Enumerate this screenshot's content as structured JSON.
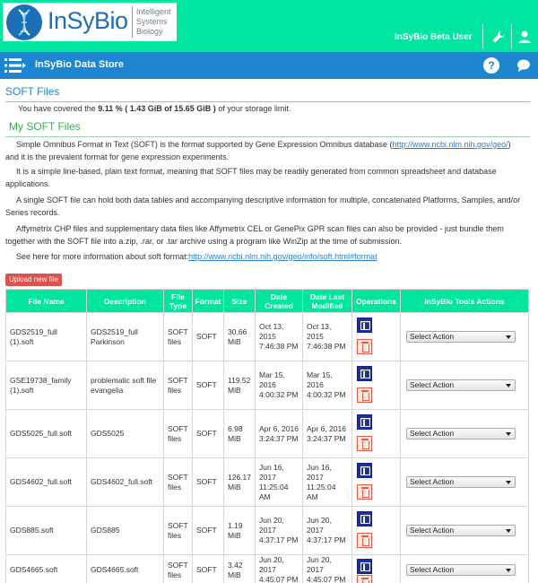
{
  "brand": {
    "logo_word": "InSyBio",
    "logo_sub": [
      "Intelligent",
      "Systems",
      "Biology"
    ]
  },
  "header": {
    "user": "InSyBio Beta User",
    "settings_icon": "wrench-icon",
    "user_icon": "user-icon"
  },
  "nav": {
    "menu_icon": "hamburger-menu-icon",
    "title": "InSyBio Data Store",
    "help_icon": "help-icon",
    "help_glyph": "?",
    "chat_icon": "chat-icon"
  },
  "page": {
    "title": "SOFT Files",
    "storage_prefix": "You have covered the ",
    "storage_value": "9.11 % ( 1.43 GiB of 15.65 GiB )",
    "storage_suffix": " of your storage limit.",
    "section_title": "My SOFT Files",
    "p1_text": "Simple Omnibus Format in Text (SOFT) is the format supported by Gene Expression Omnibus database (",
    "p1_link": "http://www.ncbi.nlm.nih.gov/geo/",
    "p1_tail": ")",
    "p1_line2": "and it is the prevalent format for gene expression experiments.",
    "p2": "It is a simple line-based, plain text format, meaning that SOFT files may be readily generated from common spreadsheet and database applications.",
    "p3": "A single SOFT file can hold both data tables and accompanying descriptive information for multiple, concatenated Platforms, Samples, and/or Series records.",
    "p4": "Affymetrix CHP files and supplementary data files like Affymetrix CEL or GenePix GPR scan files can also be provided - just bundle them together with the SOFT file into a.zip, .rar, or .tar archive using a program like WinZip at the time of submission.",
    "p5_text": "See here for more information about soft format: ",
    "p5_link": "http://www.ncbi.nlm.nih.gov/geo/info/soft.html#format",
    "upload_label": "Upload new file"
  },
  "table": {
    "headers": [
      "File Name",
      "Description",
      "File Type",
      "Format",
      "Size",
      "Date Created",
      "Date Last Modified",
      "Operations",
      "InSyBio Tools Actions"
    ],
    "rows": [
      {
        "name": "GDS2519_full (1).soft",
        "desc": "GDS2519_full Parkinson",
        "type": "SOFT files",
        "format": "SOFT",
        "size": "30.66 MiB",
        "created": "Oct 13, 2015 7:46:38 PM",
        "modified": "Oct 13, 2015 7:46:38 PM",
        "action": "Select Action"
      },
      {
        "name": "GSE19738_family (1).soft",
        "desc": "problematic soft file evangelia",
        "type": "SOFT files",
        "format": "SOFT",
        "size": "119.52 MiB",
        "created": "Mar 15, 2016 4:00:32 PM",
        "modified": "Mar 15, 2016 4:00:32 PM",
        "action": "Select Action"
      },
      {
        "name": "GDS5025_full.soft",
        "desc": "GDS5025",
        "type": "SOFT files",
        "format": "SOFT",
        "size": "6.98 MiB",
        "created": "Apr 6, 2016 3:24:37 PM",
        "modified": "Apr 6, 2016 3:24:37 PM",
        "action": "Select Action"
      },
      {
        "name": "GDS4602_full.soft",
        "desc": "GDS4602_full.soft",
        "type": "SOFT files",
        "format": "SOFT",
        "size": "126.17 MiB",
        "created": "Jun 16, 2017 11:25:04 AM",
        "modified": "Jun 16, 2017 11:25:04 AM",
        "action": "Select Action"
      },
      {
        "name": "GDS885.soft",
        "desc": "GDS885",
        "type": "SOFT files",
        "format": "SOFT",
        "size": "1.19 MiB",
        "created": "Jun 20, 2017 4:37:17 PM",
        "modified": "Jun 20, 2017 4:37:17 PM",
        "action": "Select Action"
      },
      {
        "name": "GDS4665.soft",
        "desc": "GDS4665.soft",
        "type": "SOFT files",
        "format": "SOFT",
        "size": "3.42 MiB",
        "created": "Jun 20, 2017 4:45:07 PM",
        "modified": "Jun 20, 2017 4:45:07 PM",
        "action": "Select Action"
      }
    ]
  },
  "colors": {
    "brand_green": "#00e6a1",
    "nav_blue": "#1c86d1",
    "danger_red": "#d9534f",
    "section_green": "#2fb34a"
  }
}
